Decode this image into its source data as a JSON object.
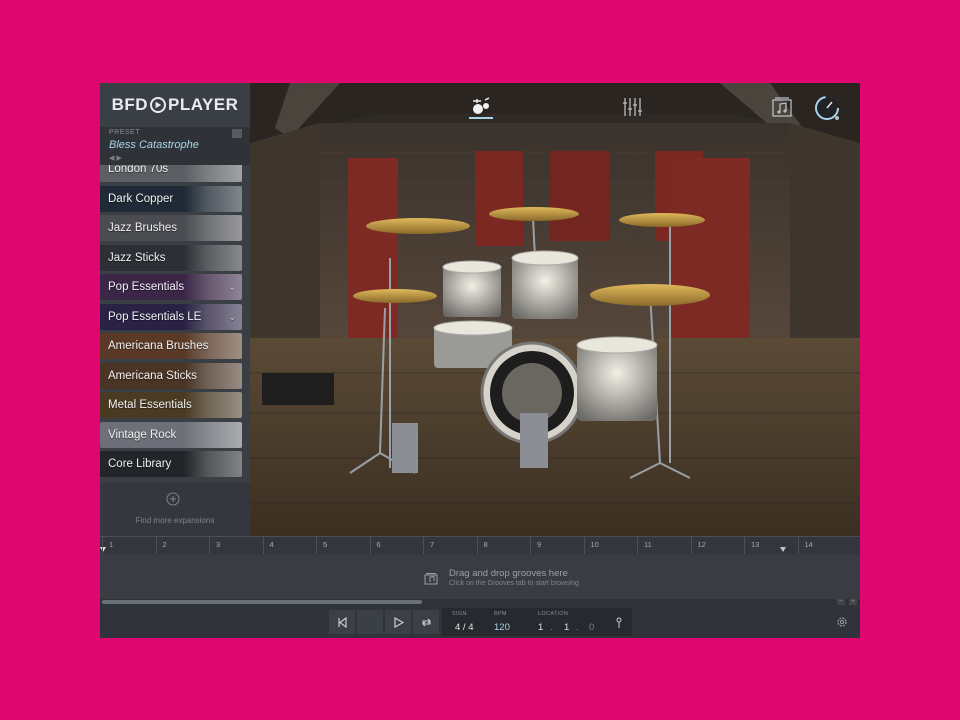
{
  "app": {
    "logo_left": "BFD",
    "logo_right": "PLAYER"
  },
  "preset": {
    "label": "PRESET",
    "name": "Bless Catastrophe"
  },
  "kits": [
    {
      "label": "London 70s",
      "color": "#5b5e63",
      "expandable": false
    },
    {
      "label": "Dark Copper",
      "color": "#1f2a36",
      "expandable": false
    },
    {
      "label": "Jazz Brushes",
      "color": "#4a4c51",
      "expandable": false
    },
    {
      "label": "Jazz Sticks",
      "color": "#2c2f35",
      "expandable": false
    },
    {
      "label": "Pop Essentials",
      "color": "#3c2648",
      "expandable": true
    },
    {
      "label": "Pop Essentials LE",
      "color": "#2a2244",
      "expandable": true
    },
    {
      "label": "Americana Brushes",
      "color": "#5a3a26",
      "expandable": false
    },
    {
      "label": "Americana Sticks",
      "color": "#4a3424",
      "expandable": false
    },
    {
      "label": "Metal Essentials",
      "color": "#4a3a22",
      "expandable": false
    },
    {
      "label": "Vintage Rock",
      "color": "#6d7078",
      "expandable": false
    },
    {
      "label": "Core Library",
      "color": "#222529",
      "expandable": false
    }
  ],
  "find_more": "Find more expansions",
  "timeline": {
    "bars": [
      "1",
      "2",
      "3",
      "4",
      "5",
      "6",
      "7",
      "8",
      "9",
      "10",
      "11",
      "12",
      "13",
      "14"
    ],
    "drop_title": "Drag and drop grooves here",
    "drop_subtitle": "Click on the Grooves tab to start browsing"
  },
  "transport": {
    "sign_label": "SIGN.",
    "sign_value": "4 / 4",
    "bpm_label": "BPM",
    "bpm_value": "120",
    "location_label": "LOCATION",
    "location_bar": "1",
    "location_beat": "1",
    "location_tick": "0"
  },
  "icons": {
    "kit_tab": "drum-kit-icon",
    "mixer_tab": "mixer-icon",
    "grooves_tab": "grooves-icon",
    "master_knob": "volume-knob-icon"
  },
  "colors": {
    "background": "#e0066f",
    "accent": "#a9d5ec"
  }
}
